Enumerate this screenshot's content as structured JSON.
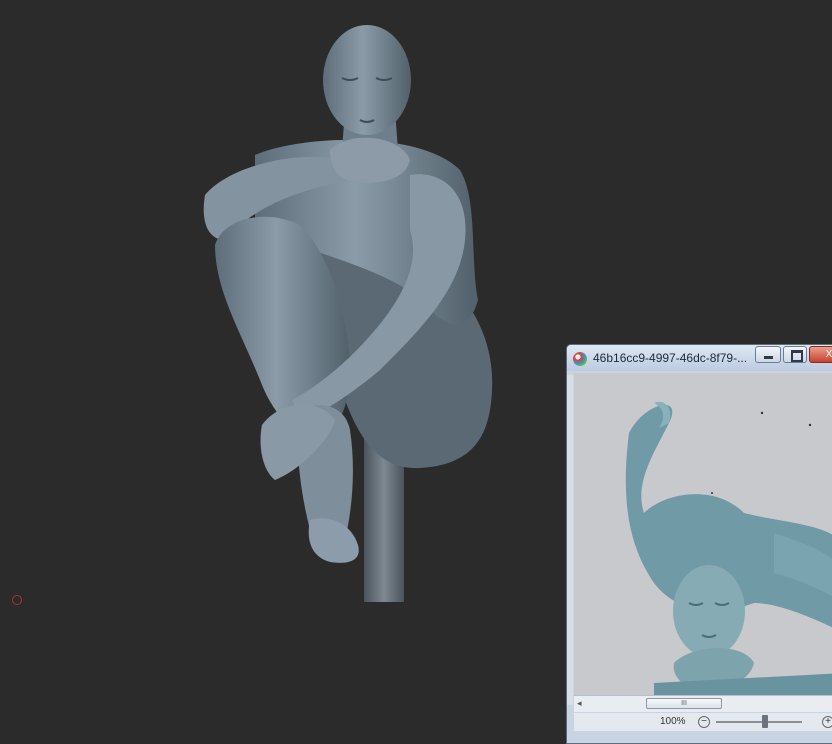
{
  "viewport": {
    "background": "#2b2b2b",
    "model_color": "#7b8c99",
    "pole_color": "#6d7781"
  },
  "image_viewer": {
    "title": "46b16cc9-4997-46dc-8f79-...",
    "buttons": {
      "minimize_icon": "minimize-icon",
      "maximize_icon": "maximize-icon",
      "close_icon": "close-icon",
      "close_glyph": "X"
    },
    "scrollbar_thumb_glyph": "III",
    "scroll_left_glyph": "◂",
    "zoom_label": "100%",
    "zoom_minus": "−",
    "zoom_plus": "+",
    "reference_colors": {
      "background": "#c8c9cc",
      "sculpture": "#6f9aa6"
    }
  }
}
